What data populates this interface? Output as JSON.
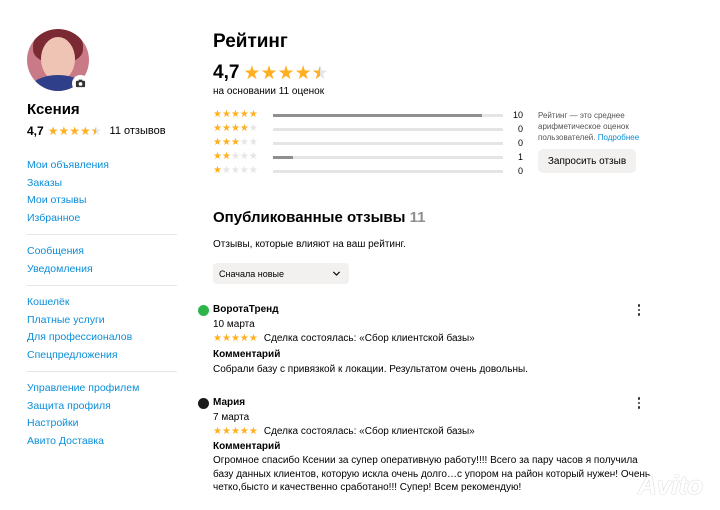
{
  "profile": {
    "name": "Ксения",
    "rating": "4,7",
    "rating_stars": 4.7,
    "reviews_count_label": "11 отзывов"
  },
  "menu": [
    [
      "Мои объявления",
      "Заказы",
      "Мои отзывы",
      "Избранное"
    ],
    [
      "Сообщения",
      "Уведомления"
    ],
    [
      "Кошелёк",
      "Платные услуги",
      "Для профессионалов",
      "Спецпредложения"
    ],
    [
      "Управление профилем",
      "Защита профиля",
      "Настройки",
      "Авито Доставка"
    ]
  ],
  "rating_section": {
    "title": "Рейтинг",
    "value": "4,7",
    "stars": 4.7,
    "basis": "на основании 11 оценок",
    "distribution": [
      {
        "stars": 5,
        "count": "10",
        "fraction": 0.91
      },
      {
        "stars": 4,
        "count": "0",
        "fraction": 0
      },
      {
        "stars": 3,
        "count": "0",
        "fraction": 0
      },
      {
        "stars": 2,
        "count": "1",
        "fraction": 0.09
      },
      {
        "stars": 1,
        "count": "0",
        "fraction": 0
      }
    ],
    "note_text": "Рейтинг — это среднее арифметическое оценок пользователей.",
    "note_link": "Подробнее",
    "request_button": "Запросить отзыв"
  },
  "reviews_section": {
    "title": "Опубликованные отзывы",
    "count": "11",
    "description": "Отзывы, которые влияют на ваш рейтинг.",
    "sort_label": "Сначала новые"
  },
  "reviews": [
    {
      "author": "ВоротаТренд",
      "date": "10 марта",
      "stars": 5,
      "deal": "Сделка состоялась: «Сбор клиентской базы»",
      "comment_heading": "Комментарий",
      "comment": "Собрали базу с привязкой к локации. Результатом очень довольны.",
      "logo_color": "#2db54a"
    },
    {
      "author": "Мария",
      "date": "7 марта",
      "stars": 5,
      "deal": "Сделка состоялась: «Сбор клиентской базы»",
      "comment_heading": "Комментарий",
      "comment": "Огромное спасибо Ксении за супер оперативную работу!!!! Всего за пару часов я получила базу данных клиентов, которую искла очень долго…с упором на район который нужен! Очень четко,бысто и качественно сработано!!! Супер! Всем рекомендую!",
      "logo_color": "#1a1a1a"
    }
  ],
  "watermark": "Avito",
  "colors": {
    "accent": "#0a8ed9",
    "star": "#ffb021",
    "star_empty": "#e5e5e5"
  }
}
